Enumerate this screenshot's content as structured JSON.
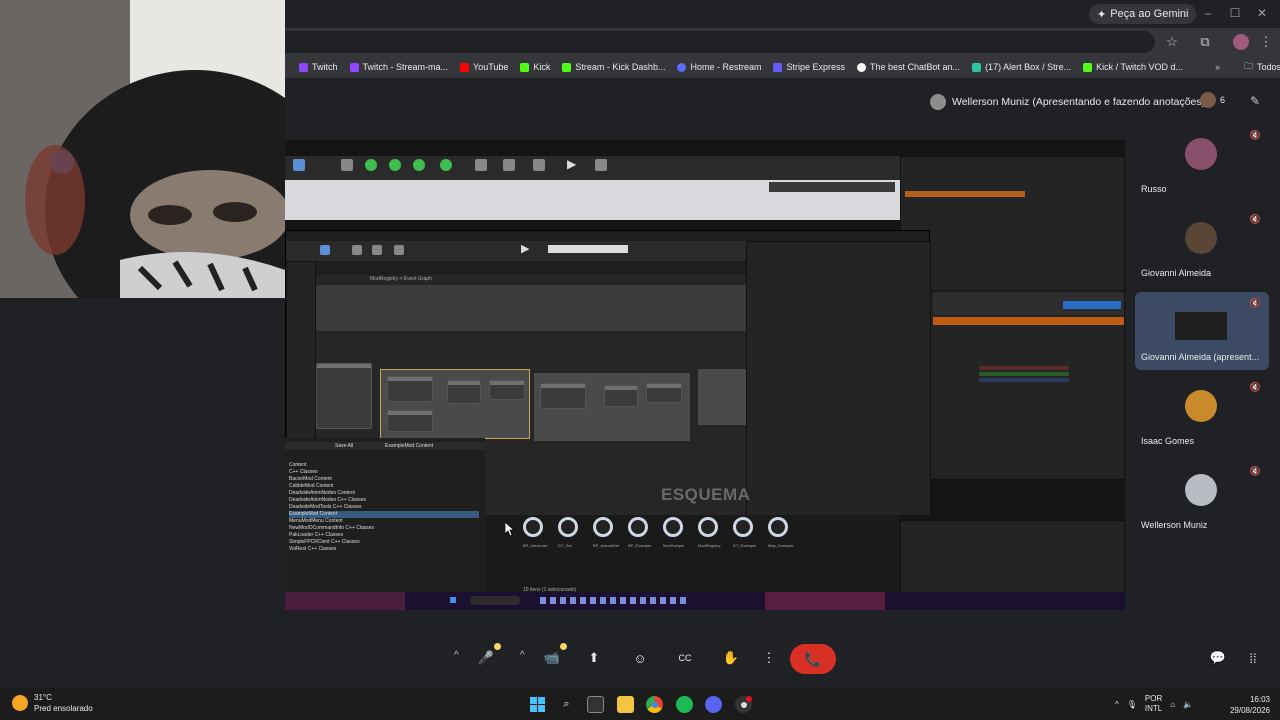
{
  "browser": {
    "gemini_label": "Peça ao Gemini",
    "window_controls": [
      "–",
      "☐",
      "✕"
    ],
    "bookmarks": [
      {
        "label": "Twitch",
        "color": "#9146ff"
      },
      {
        "label": "Twitch - Stream-ma...",
        "color": "#9146ff"
      },
      {
        "label": "YouTube",
        "color": "#ff0000"
      },
      {
        "label": "Kick",
        "color": "#53fc18"
      },
      {
        "label": "Stream - Kick Dashb...",
        "color": "#53fc18"
      },
      {
        "label": "Home - Restream",
        "color": "#5b6cff"
      },
      {
        "label": "Stripe Express",
        "color": "#635bff"
      },
      {
        "label": "The best ChatBot an...",
        "color": "#ffffff"
      },
      {
        "label": "(17) Alert Box / Stre...",
        "color": "#31c3a2"
      },
      {
        "label": "Kick / Twitch VOD d...",
        "color": "#53fc18"
      }
    ],
    "bookmarks_more": "»",
    "all_bookmarks": "Todos os favoritos"
  },
  "meet": {
    "presenter_label": "Wellerson Muniz (Apresentando e fazendo anotações)",
    "people_count": "6",
    "participants": [
      {
        "name": "Russo",
        "avatar_color": "#8a4f6b"
      },
      {
        "name": "Giovanni Almeida",
        "avatar_color": "#5a4636"
      },
      {
        "name": "Giovanni Almeida (apresent...",
        "avatar_color": "#6a7f9c"
      },
      {
        "name": "Isaac Gomes",
        "avatar_color": "#c98a2b"
      },
      {
        "name": "Wellerson Muniz",
        "avatar_color": "#b9bcc2"
      }
    ],
    "colors": {
      "end_call": "#d93025",
      "notification": "#fdd663"
    }
  },
  "shared_screen": {
    "graph_watermark": "ESQUEMA",
    "graph_tab": "ModRegistry > Event Graph",
    "content_browser": {
      "header": "Save All",
      "path": "ExampleMod Content",
      "tree": [
        "Content",
        "C++ Classes",
        "BaconMod Content",
        "CobbleMod Content",
        "DeadsideAnimNodes Content",
        "DeadsideAnimNodes C++ Classes",
        "DeadsideModTools C++ Classes",
        "ExampleMod Content",
        "MenuModMenu Content",
        "NewModOCommandInfo C++ Classes",
        "PakLoader C++ Classes",
        "SimpleFPCRCient C++ Classes",
        "VoiRest C++ Classes"
      ],
      "assets": [
        "BP_InfraLoad",
        "DT_Set",
        "BP_AnimalDef",
        "BP_Example",
        "ModSample",
        "ModRegistry",
        "DT_Example",
        "Map_Example"
      ],
      "status": "10 itens (1 selecionado)"
    }
  },
  "controls": {
    "mic_icon": "🎤",
    "cam_icon": "📹",
    "present_icon": "⬆",
    "emoji_icon": "☺",
    "captions_icon": "CC",
    "hand_icon": "✋",
    "more_icon": "⋮",
    "end_icon": "📞",
    "chat_icon": "💬",
    "activities_icon": "⁞⁞"
  },
  "taskbar": {
    "weather_temp": "31°C",
    "weather_desc": "Pred ensolarado",
    "lang_top": "POR",
    "lang_bottom": "INTL",
    "time": "16:03",
    "date": "29/08/2026"
  }
}
